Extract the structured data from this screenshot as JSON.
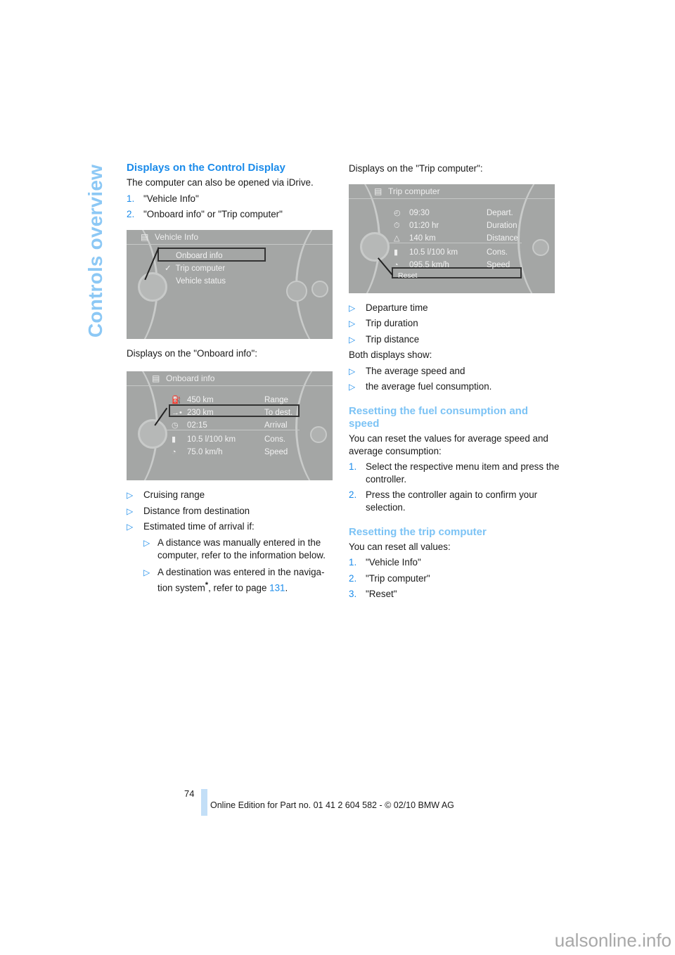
{
  "side_title": "Controls overview",
  "left": {
    "heading": "Displays on the Control Display",
    "intro": "The computer can also be opened via iDrive.",
    "steps": [
      {
        "n": "1.",
        "text": "\"Vehicle Info\""
      },
      {
        "n": "2.",
        "text": "\"Onboard info\" or \"Trip computer\""
      }
    ],
    "screen1": {
      "title": "Vehicle Info",
      "items": [
        "Onboard info",
        "Trip computer",
        "Vehicle status"
      ],
      "checked_icon": "✓"
    },
    "onboard_caption": "Displays on the \"Onboard info\":",
    "screen2": {
      "title": "Onboard info",
      "rows": [
        {
          "icon": "fuel-range-icon",
          "glyph": "⛽",
          "value": "450  km",
          "label": "Range"
        },
        {
          "icon": "destination-icon",
          "glyph": "→•",
          "value": "230  km",
          "label": "To dest."
        },
        {
          "icon": "arrival-clock-icon",
          "glyph": "◷",
          "value": "02:15",
          "label": "Arrival"
        },
        {
          "icon": "fuel-pump-icon",
          "glyph": "▮",
          "value": "10.5 l/100 km",
          "label": "Cons."
        },
        {
          "icon": "speedometer-icon",
          "glyph": "◔",
          "value": "75.0 km/h",
          "label": "Speed"
        }
      ]
    },
    "bullets": [
      "Cruising range",
      "Distance from destination",
      "Estimated time of arrival if:"
    ],
    "sub_bullets": [
      "A distance was manually entered in the computer, refer to the information below.",
      "A destination was entered in the naviga-tion system"
    ],
    "sub_tail": ", refer to page ",
    "page_ref": "131",
    "asterisk": "*"
  },
  "right": {
    "trip_caption": "Displays on the \"Trip computer\":",
    "screen3": {
      "title": "Trip computer",
      "rows": [
        {
          "icon": "departure-clock-icon",
          "glyph": "◴",
          "value": "09:30",
          "label": "Depart."
        },
        {
          "icon": "stopwatch-icon",
          "glyph": "⏱",
          "value": "01:20  hr",
          "label": "Duration"
        },
        {
          "icon": "distance-icon",
          "glyph": "△",
          "value": "140    km",
          "label": "Distance"
        },
        {
          "icon": "fuel-pump-icon",
          "glyph": "▮",
          "value": "10.5 l/100 km",
          "label": "Cons."
        },
        {
          "icon": "speedometer-icon",
          "glyph": "◔",
          "value": "095.5 km/h",
          "label": "Speed"
        }
      ],
      "reset": "Reset"
    },
    "bullets1": [
      "Departure time",
      "Trip duration",
      "Trip distance"
    ],
    "both": "Both displays show:",
    "bullets2": [
      "The average speed and",
      "the average fuel consumption."
    ],
    "heading2": "Resetting the fuel consumption and speed",
    "para2": "You can reset the values for average speed and average consumption:",
    "steps2": [
      {
        "n": "1.",
        "text": "Select the respective menu item and press the controller."
      },
      {
        "n": "2.",
        "text": "Press the controller again to confirm your selection."
      }
    ],
    "heading3": "Resetting the trip computer",
    "para3": "You can reset all values:",
    "steps3": [
      {
        "n": "1.",
        "text": "\"Vehicle Info\""
      },
      {
        "n": "2.",
        "text": "\"Trip computer\""
      },
      {
        "n": "3.",
        "text": "\"Reset\""
      }
    ]
  },
  "footer": {
    "page_number": "74",
    "edition": "Online Edition for Part no. 01 41 2 604 582 - © 02/10 BMW AG"
  },
  "watermark": "ualsonline.info",
  "bullet_glyph": "▷"
}
